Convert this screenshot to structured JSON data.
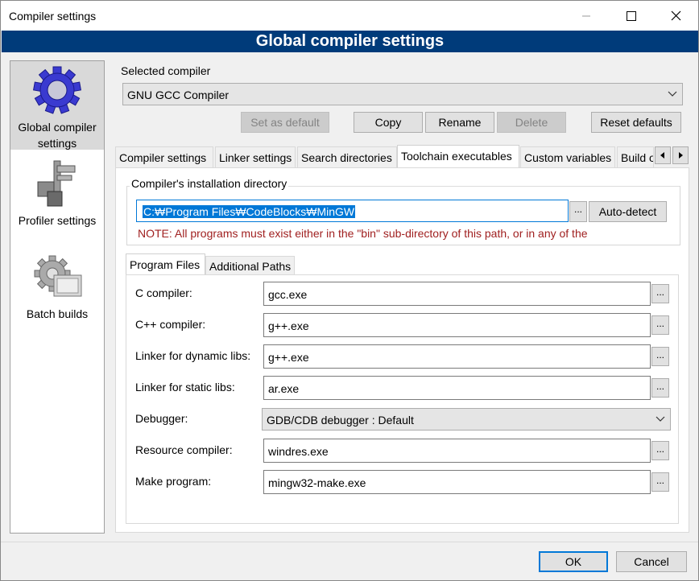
{
  "window": {
    "title": "Compiler settings",
    "banner": "Global compiler settings"
  },
  "sidebar": {
    "items": [
      {
        "label_line1": "Global compiler",
        "label_line2": "settings",
        "icon": "gear-icon",
        "selected": true
      },
      {
        "label": "Profiler settings",
        "icon": "caliper-icon"
      },
      {
        "label": "Batch builds",
        "icon": "gear-stack-icon"
      }
    ]
  },
  "compiler": {
    "section_label": "Selected compiler",
    "selected": "GNU GCC Compiler",
    "buttons": {
      "set_default": "Set as default",
      "copy": "Copy",
      "rename": "Rename",
      "delete": "Delete",
      "reset": "Reset defaults"
    }
  },
  "tabs": [
    "Compiler settings",
    "Linker settings",
    "Search directories",
    "Toolchain executables",
    "Custom variables",
    "Build o"
  ],
  "active_tab": "Toolchain executables",
  "toolchain": {
    "install_dir_label": "Compiler's installation directory",
    "install_dir": "C:₩Program Files₩CodeBlocks₩MinGW",
    "browse": "...",
    "autodetect": "Auto-detect",
    "note": "NOTE: All programs must exist either in the \"bin\" sub-directory of this path, or in any of the",
    "subtabs": [
      "Program Files",
      "Additional Paths"
    ],
    "programs": [
      {
        "label": "C compiler:",
        "value": "gcc.exe"
      },
      {
        "label": "C++ compiler:",
        "value": "g++.exe"
      },
      {
        "label": "Linker for dynamic libs:",
        "value": "g++.exe"
      },
      {
        "label": "Linker for static libs:",
        "value": "ar.exe"
      },
      {
        "label": "Debugger:",
        "value": "GDB/CDB debugger : Default"
      },
      {
        "label": "Resource compiler:",
        "value": "windres.exe"
      },
      {
        "label": "Make program:",
        "value": "mingw32-make.exe"
      }
    ]
  },
  "footer": {
    "ok": "OK",
    "cancel": "Cancel"
  },
  "colors": {
    "banner": "#003b7a",
    "note": "#a02020",
    "selection": "#0078d7"
  }
}
